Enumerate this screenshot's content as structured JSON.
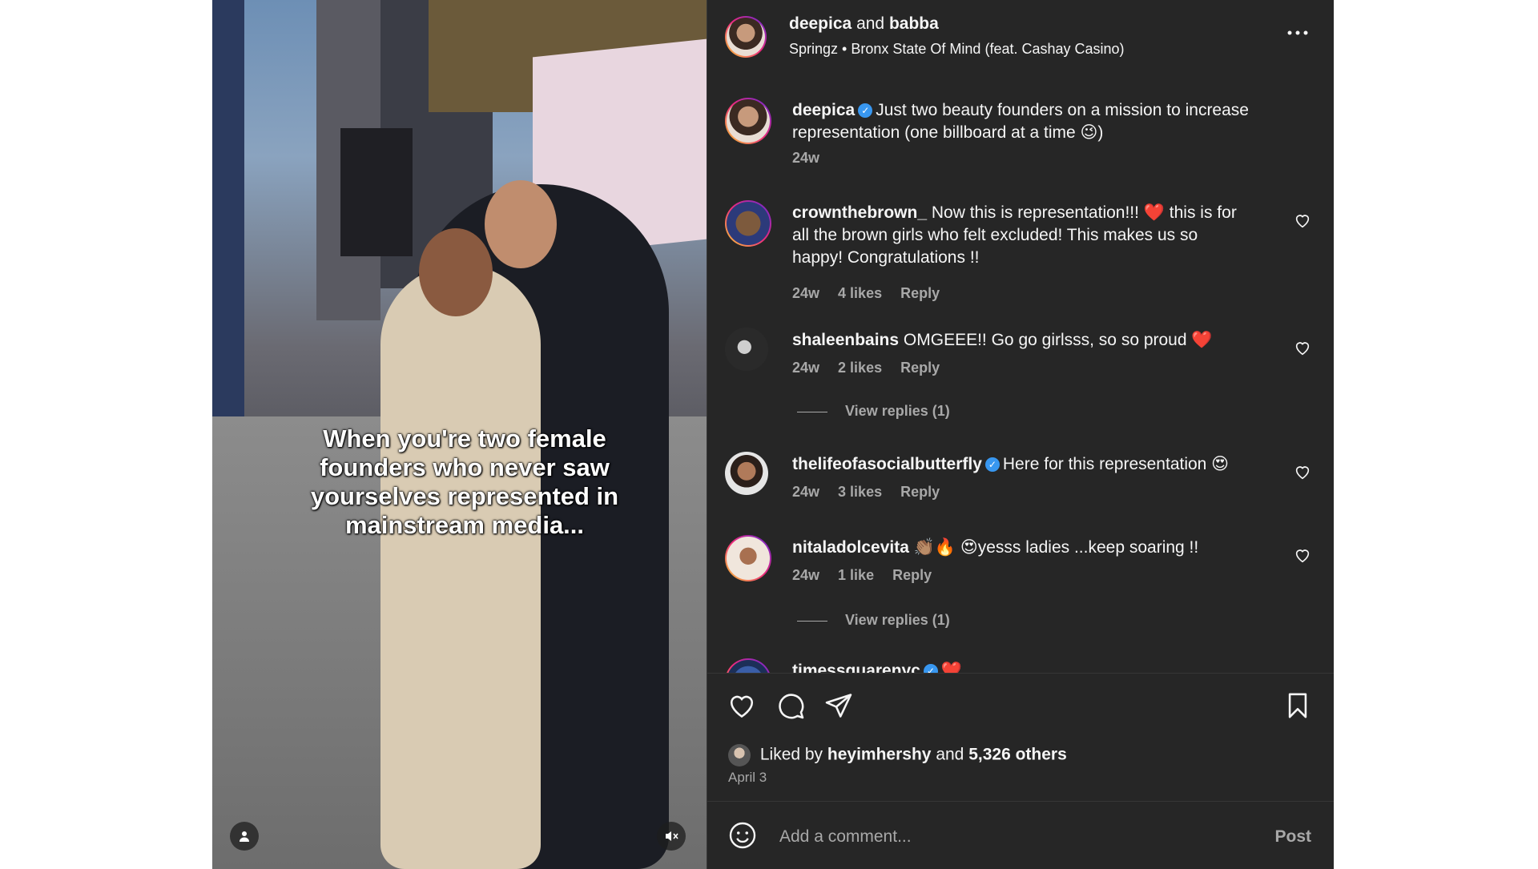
{
  "media": {
    "caption": "When you're two female founders who never saw yourselves represented in mainstream media..."
  },
  "header": {
    "user1": "deepica",
    "and_text": "and",
    "user2": "babba",
    "audio_artist": "Springz",
    "audio_separator": "•",
    "audio_title": "Bronx State Of Mind (feat. Cashay Casino)"
  },
  "post_caption": {
    "username": "deepica",
    "text": "Just two beauty founders on a mission to increase representation (one billboard at a time 😉)",
    "time": "24w"
  },
  "comments": [
    {
      "username": "crownthebrown_",
      "text": "Now this is representation!!! ❤️ this is for all the brown girls who felt excluded! This makes us so happy! Congratulations !!",
      "time": "24w",
      "likes": "4 likes",
      "reply": "Reply"
    },
    {
      "username": "shaleenbains",
      "text": "OMGEEE!! Go go girlsss, so so proud ❤️",
      "time": "24w",
      "likes": "2 likes",
      "reply": "Reply",
      "view_replies": "View replies (1)"
    },
    {
      "username": "thelifeofasocialbutterfly",
      "text": "Here for this representation 😍",
      "time": "24w",
      "likes": "3 likes",
      "reply": "Reply"
    },
    {
      "username": "nitaladolcevita",
      "text": "👏🏽🔥 😍yesss ladies ...keep soaring !!",
      "time": "24w",
      "likes": "1 like",
      "reply": "Reply",
      "view_replies": "View replies (1)"
    },
    {
      "username": "timessquarenyc",
      "text": "❤️"
    }
  ],
  "likes": {
    "prefix": "Liked by",
    "user": "heyimhershy",
    "and_text": "and",
    "others": "5,326 others"
  },
  "date": "April 3",
  "comment_input": {
    "placeholder": "Add a comment..."
  },
  "post_label": "Post",
  "icons": {
    "more": "more-icon",
    "like": "heart-icon",
    "comment": "comment-icon",
    "share": "share-icon",
    "save": "bookmark-icon",
    "emoji": "emoji-icon",
    "mute": "muted-icon",
    "tag": "user-tag-icon"
  },
  "colors": {
    "panel_bg": "#262626",
    "text": "#f5f5f5",
    "secondary": "#a8a8a8",
    "verified": "#3897f0",
    "heart": "#ed4956"
  }
}
